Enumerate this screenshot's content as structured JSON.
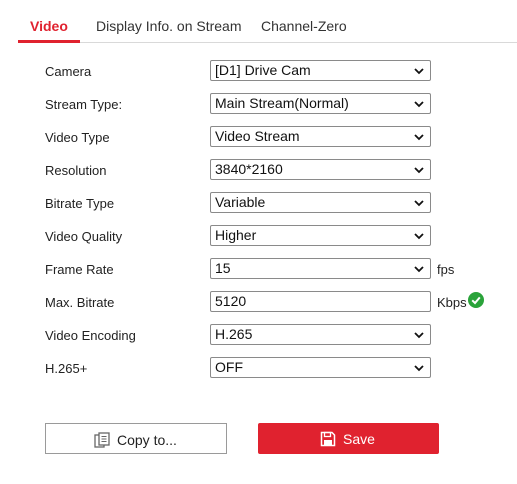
{
  "tabs": [
    {
      "label": "Video",
      "active": true
    },
    {
      "label": "Display Info. on Stream",
      "active": false
    },
    {
      "label": "Channel-Zero",
      "active": false
    }
  ],
  "form": {
    "camera": {
      "label": "Camera",
      "value": "[D1] Drive Cam"
    },
    "stream_type": {
      "label": "Stream Type:",
      "value": "Main Stream(Normal)"
    },
    "video_type": {
      "label": "Video Type",
      "value": "Video Stream"
    },
    "resolution": {
      "label": "Resolution",
      "value": "3840*2160"
    },
    "bitrate_type": {
      "label": "Bitrate Type",
      "value": "Variable"
    },
    "video_quality": {
      "label": "Video Quality",
      "value": "Higher"
    },
    "frame_rate": {
      "label": "Frame Rate",
      "value": "15",
      "unit": "fps"
    },
    "max_bitrate": {
      "label": "Max. Bitrate",
      "value": "5120",
      "unit": "Kbps"
    },
    "video_encoding": {
      "label": "Video Encoding",
      "value": "H.265"
    },
    "h265_plus": {
      "label": "H.265+",
      "value": "OFF"
    }
  },
  "buttons": {
    "copy_label": "Copy to...",
    "save_label": "Save"
  },
  "colors": {
    "accent": "#e0222f",
    "success": "#2aa33a"
  },
  "icons": [
    "chevron-down-icon",
    "check-circle-icon",
    "copy-icon",
    "save-icon"
  ]
}
